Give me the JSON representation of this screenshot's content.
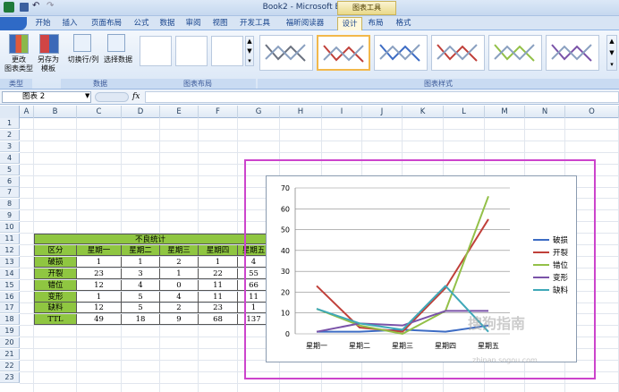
{
  "window": {
    "title": "Book2 - Microsoft Excel",
    "context_tab_group": "图表工具"
  },
  "tabs": [
    "开始",
    "插入",
    "页面布局",
    "公式",
    "数据",
    "审阅",
    "视图",
    "开发工具",
    "福昕阅读器",
    "设计",
    "布局",
    "格式"
  ],
  "active_tab": "设计",
  "ribbon": {
    "change_type": "更改\n图表类型",
    "save_template": "另存为\n模板",
    "switch_rowcol": "切换行/列",
    "select_data": "选择数据",
    "groups": {
      "type": "类型",
      "data": "数据",
      "layout": "图表布局",
      "styles": "图表样式"
    }
  },
  "formula_bar": {
    "name_box": "图表 2",
    "fx": "fx",
    "content": ""
  },
  "columns": [
    "A",
    "B",
    "C",
    "D",
    "E",
    "F",
    "G",
    "H",
    "I",
    "J",
    "K",
    "L",
    "M",
    "N",
    "O"
  ],
  "rows": [
    "1",
    "2",
    "3",
    "4",
    "5",
    "6",
    "7",
    "8",
    "9",
    "10",
    "11",
    "12",
    "13",
    "14",
    "15",
    "16",
    "17",
    "18",
    "19",
    "20",
    "21",
    "22",
    "23"
  ],
  "table": {
    "title": "不良统计",
    "header": [
      "区分",
      "星期一",
      "星期二",
      "星期三",
      "星期四",
      "星期五"
    ],
    "rows": [
      [
        "破损",
        "1",
        "1",
        "2",
        "1",
        "4"
      ],
      [
        "开裂",
        "23",
        "3",
        "1",
        "22",
        "55"
      ],
      [
        "错位",
        "12",
        "4",
        "0",
        "11",
        "66"
      ],
      [
        "变形",
        "1",
        "5",
        "4",
        "11",
        "11"
      ],
      [
        "缺料",
        "12",
        "5",
        "2",
        "23",
        "1"
      ],
      [
        "TTL",
        "49",
        "18",
        "9",
        "68",
        "137"
      ]
    ]
  },
  "watermark": "搜狗指南",
  "watermark_url": "zhinan.sogou.com",
  "chart_data": {
    "type": "line",
    "categories": [
      "星期一",
      "星期二",
      "星期三",
      "星期四",
      "星期五"
    ],
    "ylim": [
      0,
      70
    ],
    "yticks": [
      "0",
      "10",
      "20",
      "30",
      "40",
      "50",
      "60",
      "70"
    ],
    "grid": true,
    "legend": "right",
    "series": [
      {
        "name": "破损",
        "values": [
          1,
          1,
          2,
          1,
          4
        ],
        "color": "#3d6cc4"
      },
      {
        "name": "开裂",
        "values": [
          23,
          3,
          1,
          22,
          55
        ],
        "color": "#c0403a"
      },
      {
        "name": "错位",
        "values": [
          12,
          4,
          0,
          11,
          66
        ],
        "color": "#93c048"
      },
      {
        "name": "变形",
        "values": [
          1,
          5,
          4,
          11,
          11
        ],
        "color": "#7a53a8"
      },
      {
        "name": "缺料",
        "values": [
          12,
          5,
          2,
          23,
          1
        ],
        "color": "#3fa8b8"
      }
    ]
  }
}
